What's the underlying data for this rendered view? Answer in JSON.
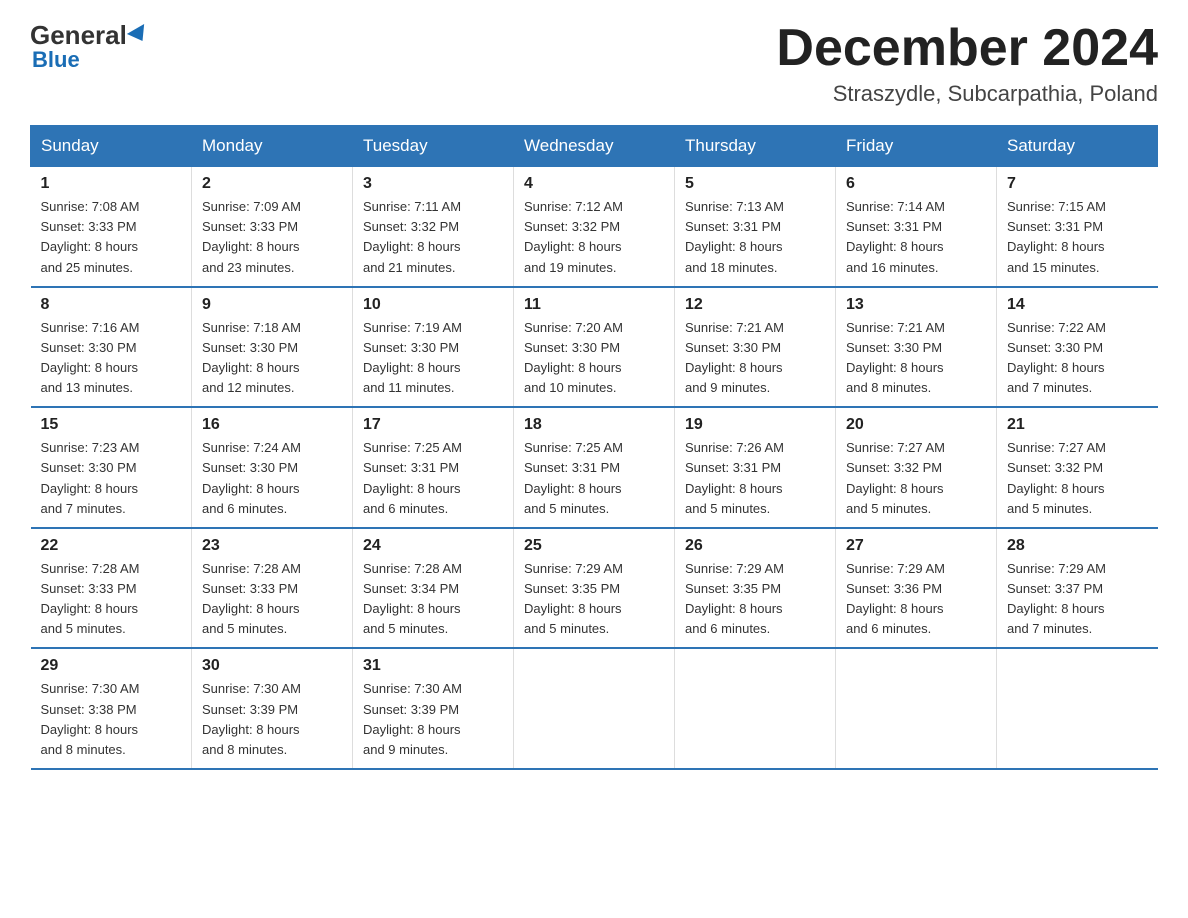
{
  "header": {
    "logo_general": "General",
    "logo_blue": "Blue",
    "title": "December 2024",
    "subtitle": "Straszydle, Subcarpathia, Poland"
  },
  "days_of_week": [
    "Sunday",
    "Monday",
    "Tuesday",
    "Wednesday",
    "Thursday",
    "Friday",
    "Saturday"
  ],
  "weeks": [
    [
      {
        "day": "1",
        "sunrise": "7:08 AM",
        "sunset": "3:33 PM",
        "daylight": "8 hours and 25 minutes."
      },
      {
        "day": "2",
        "sunrise": "7:09 AM",
        "sunset": "3:33 PM",
        "daylight": "8 hours and 23 minutes."
      },
      {
        "day": "3",
        "sunrise": "7:11 AM",
        "sunset": "3:32 PM",
        "daylight": "8 hours and 21 minutes."
      },
      {
        "day": "4",
        "sunrise": "7:12 AM",
        "sunset": "3:32 PM",
        "daylight": "8 hours and 19 minutes."
      },
      {
        "day": "5",
        "sunrise": "7:13 AM",
        "sunset": "3:31 PM",
        "daylight": "8 hours and 18 minutes."
      },
      {
        "day": "6",
        "sunrise": "7:14 AM",
        "sunset": "3:31 PM",
        "daylight": "8 hours and 16 minutes."
      },
      {
        "day": "7",
        "sunrise": "7:15 AM",
        "sunset": "3:31 PM",
        "daylight": "8 hours and 15 minutes."
      }
    ],
    [
      {
        "day": "8",
        "sunrise": "7:16 AM",
        "sunset": "3:30 PM",
        "daylight": "8 hours and 13 minutes."
      },
      {
        "day": "9",
        "sunrise": "7:18 AM",
        "sunset": "3:30 PM",
        "daylight": "8 hours and 12 minutes."
      },
      {
        "day": "10",
        "sunrise": "7:19 AM",
        "sunset": "3:30 PM",
        "daylight": "8 hours and 11 minutes."
      },
      {
        "day": "11",
        "sunrise": "7:20 AM",
        "sunset": "3:30 PM",
        "daylight": "8 hours and 10 minutes."
      },
      {
        "day": "12",
        "sunrise": "7:21 AM",
        "sunset": "3:30 PM",
        "daylight": "8 hours and 9 minutes."
      },
      {
        "day": "13",
        "sunrise": "7:21 AM",
        "sunset": "3:30 PM",
        "daylight": "8 hours and 8 minutes."
      },
      {
        "day": "14",
        "sunrise": "7:22 AM",
        "sunset": "3:30 PM",
        "daylight": "8 hours and 7 minutes."
      }
    ],
    [
      {
        "day": "15",
        "sunrise": "7:23 AM",
        "sunset": "3:30 PM",
        "daylight": "8 hours and 7 minutes."
      },
      {
        "day": "16",
        "sunrise": "7:24 AM",
        "sunset": "3:30 PM",
        "daylight": "8 hours and 6 minutes."
      },
      {
        "day": "17",
        "sunrise": "7:25 AM",
        "sunset": "3:31 PM",
        "daylight": "8 hours and 6 minutes."
      },
      {
        "day": "18",
        "sunrise": "7:25 AM",
        "sunset": "3:31 PM",
        "daylight": "8 hours and 5 minutes."
      },
      {
        "day": "19",
        "sunrise": "7:26 AM",
        "sunset": "3:31 PM",
        "daylight": "8 hours and 5 minutes."
      },
      {
        "day": "20",
        "sunrise": "7:27 AM",
        "sunset": "3:32 PM",
        "daylight": "8 hours and 5 minutes."
      },
      {
        "day": "21",
        "sunrise": "7:27 AM",
        "sunset": "3:32 PM",
        "daylight": "8 hours and 5 minutes."
      }
    ],
    [
      {
        "day": "22",
        "sunrise": "7:28 AM",
        "sunset": "3:33 PM",
        "daylight": "8 hours and 5 minutes."
      },
      {
        "day": "23",
        "sunrise": "7:28 AM",
        "sunset": "3:33 PM",
        "daylight": "8 hours and 5 minutes."
      },
      {
        "day": "24",
        "sunrise": "7:28 AM",
        "sunset": "3:34 PM",
        "daylight": "8 hours and 5 minutes."
      },
      {
        "day": "25",
        "sunrise": "7:29 AM",
        "sunset": "3:35 PM",
        "daylight": "8 hours and 5 minutes."
      },
      {
        "day": "26",
        "sunrise": "7:29 AM",
        "sunset": "3:35 PM",
        "daylight": "8 hours and 6 minutes."
      },
      {
        "day": "27",
        "sunrise": "7:29 AM",
        "sunset": "3:36 PM",
        "daylight": "8 hours and 6 minutes."
      },
      {
        "day": "28",
        "sunrise": "7:29 AM",
        "sunset": "3:37 PM",
        "daylight": "8 hours and 7 minutes."
      }
    ],
    [
      {
        "day": "29",
        "sunrise": "7:30 AM",
        "sunset": "3:38 PM",
        "daylight": "8 hours and 8 minutes."
      },
      {
        "day": "30",
        "sunrise": "7:30 AM",
        "sunset": "3:39 PM",
        "daylight": "8 hours and 8 minutes."
      },
      {
        "day": "31",
        "sunrise": "7:30 AM",
        "sunset": "3:39 PM",
        "daylight": "8 hours and 9 minutes."
      },
      null,
      null,
      null,
      null
    ]
  ],
  "labels": {
    "sunrise": "Sunrise:",
    "sunset": "Sunset:",
    "daylight": "Daylight:"
  }
}
